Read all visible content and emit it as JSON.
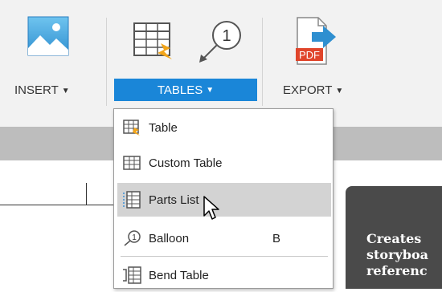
{
  "ribbon": {
    "insert_label": "INSERT",
    "tables_label": "TABLES",
    "export_label": "EXPORT",
    "balloon_number": "1",
    "pdf_text": "PDF"
  },
  "menu": {
    "items": [
      {
        "label": "Table",
        "icon": "table-icon"
      },
      {
        "label": "Custom Table",
        "icon": "custom-table-icon"
      },
      {
        "label": "Parts List",
        "icon": "parts-list-icon"
      },
      {
        "label": "Balloon",
        "icon": "balloon-icon",
        "shortcut": "B"
      },
      {
        "label": "Bend Table",
        "icon": "bend-table-icon"
      }
    ]
  },
  "tooltip": {
    "lines": [
      "Creates",
      "storyboa",
      "referenc"
    ]
  },
  "colors": {
    "accent": "#1a86d8",
    "ribbon_bg": "#f2f2f2",
    "hover_bg": "#d3d3d3",
    "tooltip_bg": "#4a4a4a"
  }
}
